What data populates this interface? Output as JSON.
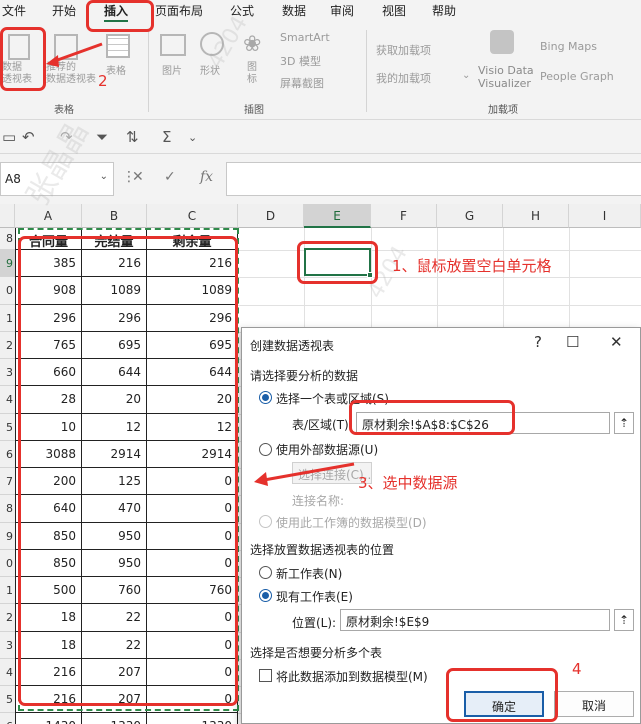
{
  "menu": [
    "文件",
    "开始",
    "插入",
    "页面布局",
    "公式",
    "数据",
    "审阅",
    "视图",
    "帮助"
  ],
  "ribbon": {
    "tables": {
      "items": [
        "数据\n透视表",
        "推荐的\n数据透视表",
        "表格"
      ],
      "group": "表格"
    },
    "illustrations": {
      "items": [
        "图片",
        "形状",
        "图\n标"
      ],
      "side": [
        "SmartArt",
        "3D 模型",
        "屏幕截图"
      ],
      "group": "插图"
    },
    "addins": {
      "items": [
        "获取加载项",
        "我的加载项",
        "Visio Data\nVisualizer",
        "Bing Maps",
        "People Graph"
      ],
      "group": "加载项"
    }
  },
  "formula_bar": {
    "name_box": "A8",
    "formula": ""
  },
  "grid": {
    "columns": [
      "A",
      "B",
      "C",
      "D",
      "E",
      "F",
      "G",
      "H",
      "I"
    ],
    "rows": [
      "8",
      "9",
      "0",
      "1",
      "2",
      "3",
      "4",
      "5",
      "6",
      "7",
      "8",
      "9",
      "0",
      "1",
      "2",
      "3",
      "4",
      "5",
      "6"
    ],
    "headers": [
      "合同量",
      "完结量",
      "剩余量"
    ],
    "data": [
      [
        "385",
        "216",
        "216"
      ],
      [
        "908",
        "1089",
        "1089"
      ],
      [
        "296",
        "296",
        "296"
      ],
      [
        "765",
        "695",
        "695"
      ],
      [
        "660",
        "644",
        "644"
      ],
      [
        "28",
        "20",
        "20"
      ],
      [
        "10",
        "12",
        "12"
      ],
      [
        "3088",
        "2914",
        "2914"
      ],
      [
        "200",
        "125",
        "0"
      ],
      [
        "640",
        "470",
        "0"
      ],
      [
        "850",
        "950",
        "0"
      ],
      [
        "850",
        "950",
        "0"
      ],
      [
        "500",
        "760",
        "760"
      ],
      [
        "18",
        "22",
        "0"
      ],
      [
        "18",
        "22",
        "0"
      ],
      [
        "216",
        "207",
        "0"
      ],
      [
        "216",
        "207",
        "0"
      ],
      [
        "1430",
        "1330",
        "1330"
      ]
    ]
  },
  "annotations": {
    "step2": "2",
    "step1": "1、鼠标放置空白单元格",
    "step3": "3、选中数据源",
    "step4": "4"
  },
  "watermarks": [
    "张晶晶",
    "4204",
    "张晶晶",
    "4204",
    "4204"
  ],
  "dialog": {
    "title": "创建数据透视表",
    "section1": "请选择要分析的数据",
    "opt_table": "选择一个表或区域(S)",
    "range_label": "表/区域(T):",
    "range_value": "原材剩余!$A$8:$C$26",
    "opt_external": "使用外部数据源(U)",
    "choose_conn": "选择连接(C)...",
    "conn_name": "连接名称:",
    "opt_model": "使用此工作簿的数据模型(D)",
    "section2": "选择放置数据透视表的位置",
    "opt_new_sheet": "新工作表(N)",
    "opt_existing": "现有工作表(E)",
    "location_label": "位置(L):",
    "location_value": "原材剩余!$E$9",
    "section3": "选择是否想要分析多个表",
    "add_model": "将此数据添加到数据模型(M)",
    "ok": "确定",
    "cancel": "取消"
  },
  "colors": {
    "annotation": "#e5312c",
    "excel_green": "#217346",
    "selection_blue": "#1a5ea8"
  }
}
